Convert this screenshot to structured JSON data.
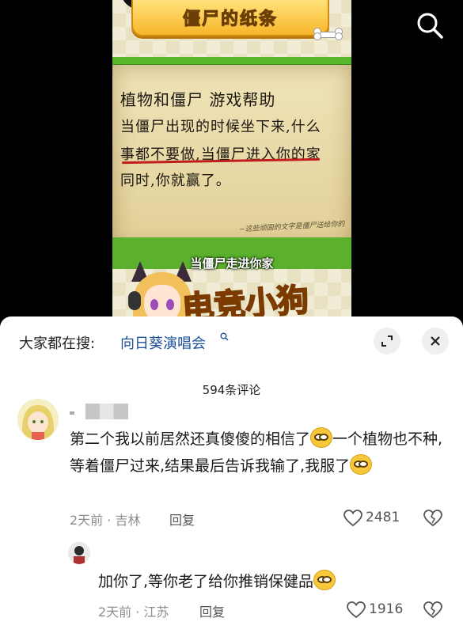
{
  "video": {
    "banner_title": "僵尸的纸条",
    "note_lines": [
      "植物和僵尸 游戏帮助",
      "当僵尸出现的时候坐下来,什么",
      "事都不要做,当僵尸进入你的家",
      "同时,你就赢了。"
    ],
    "note_footer": "~这些顽固的文字是僵尸送给你的",
    "caption": "当僵尸走进你家",
    "sticker_text": "电竞小狗",
    "search_icon": "search-icon"
  },
  "sheet": {
    "search_hint_label": "大家都在搜:",
    "search_hint_term": "向日葵演唱会",
    "expand_icon": "expand-icon",
    "close_icon": "close-icon",
    "comment_count": "594条评论"
  },
  "comments": [
    {
      "text_part1": "第二个我以前居然还真傻傻的相信了",
      "text_part2": "一个植物也不种,等着僵尸过来,结果最后告诉我输了,我服了",
      "meta": "2天前 · 吉林",
      "reply": "回复",
      "likes": "2481"
    },
    {
      "text": "加你了,等你老了给你推销保健品",
      "meta": "2天前 · 江苏",
      "reply": "回复",
      "likes": "1916"
    }
  ],
  "colors": {
    "accent_link": "#1c4f9c",
    "meta_gray": "#8e8e8e"
  }
}
